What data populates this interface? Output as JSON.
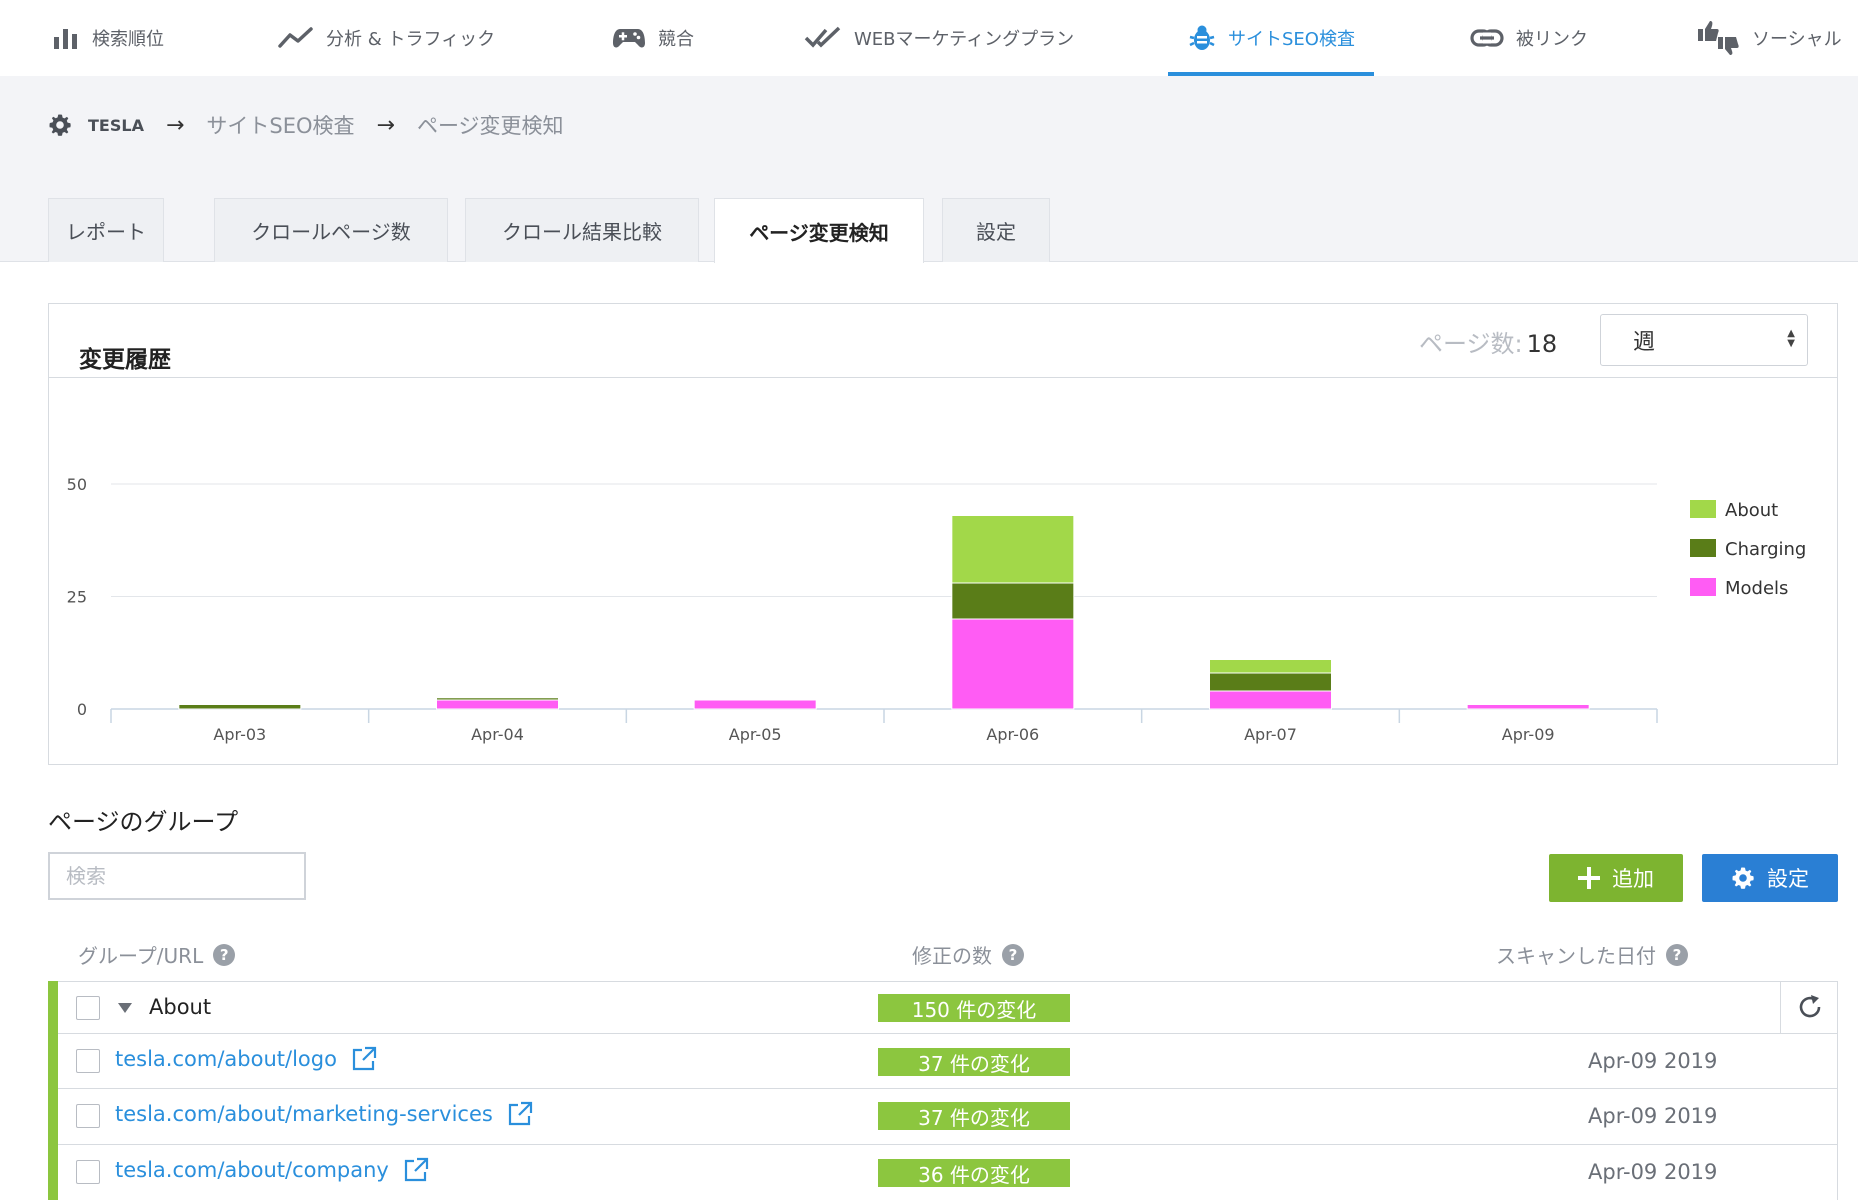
{
  "nav": {
    "items": [
      {
        "label": "検索順位",
        "icon": "bar-chart-icon"
      },
      {
        "label": "分析 & トラフィック",
        "icon": "trend-line-icon"
      },
      {
        "label": "競合",
        "icon": "gamepad-icon"
      },
      {
        "label": "WEBマーケティングプラン",
        "icon": "double-check-icon"
      },
      {
        "label": "サイトSEO検査",
        "icon": "bug-icon",
        "active": true
      },
      {
        "label": "被リンク",
        "icon": "link-icon"
      },
      {
        "label": "ソーシャル",
        "icon": "thumbs-icon"
      }
    ],
    "active_color": "#2a8fdc"
  },
  "breadcrumb": {
    "root": "TESLA",
    "items": [
      "サイトSEO検査",
      "ページ変更検知"
    ]
  },
  "tabs": [
    {
      "label": "レポート"
    },
    {
      "label": "クロールページ数"
    },
    {
      "label": "クロール結果比較"
    },
    {
      "label": "ページ変更検知",
      "active": true
    },
    {
      "label": "設定"
    }
  ],
  "history_panel": {
    "title": "変更履歴",
    "page_count_label": "ページ数:",
    "page_count_value": "18",
    "period_selected": "週"
  },
  "chart_data": {
    "type": "bar",
    "stacked": true,
    "categories": [
      "Apr-03",
      "Apr-04",
      "Apr-05",
      "Apr-06",
      "Apr-07",
      "Apr-09"
    ],
    "series": [
      {
        "name": "Models",
        "color": "#ff5cf4",
        "values": [
          0,
          2,
          2,
          20,
          4,
          1
        ]
      },
      {
        "name": "Charging",
        "color": "#5a7d18",
        "values": [
          1,
          0.5,
          0,
          8,
          4,
          0
        ]
      },
      {
        "name": "About",
        "color": "#a2d849",
        "values": [
          0,
          0,
          0,
          15,
          3,
          0
        ]
      }
    ],
    "ylim": [
      0,
      50
    ],
    "yticks": [
      0,
      25,
      50
    ],
    "grid": true,
    "legend_position": "right"
  },
  "groups": {
    "title": "ページのグループ",
    "search_placeholder": "検索",
    "add_button": "追加",
    "settings_button": "設定",
    "columns": {
      "url": "グループ/URL",
      "changes": "修正の数",
      "scan_date": "スキャンした日付"
    },
    "group": {
      "name": "About",
      "changes": "150 件の変化"
    },
    "rows": [
      {
        "url": "tesla.com/about/logo",
        "changes": "37 件の変化",
        "date": "Apr-09 2019"
      },
      {
        "url": "tesla.com/about/marketing-services",
        "changes": "37 件の変化",
        "date": "Apr-09 2019"
      },
      {
        "url": "tesla.com/about/company",
        "changes": "36 件の変化",
        "date": "Apr-09 2019"
      }
    ]
  }
}
